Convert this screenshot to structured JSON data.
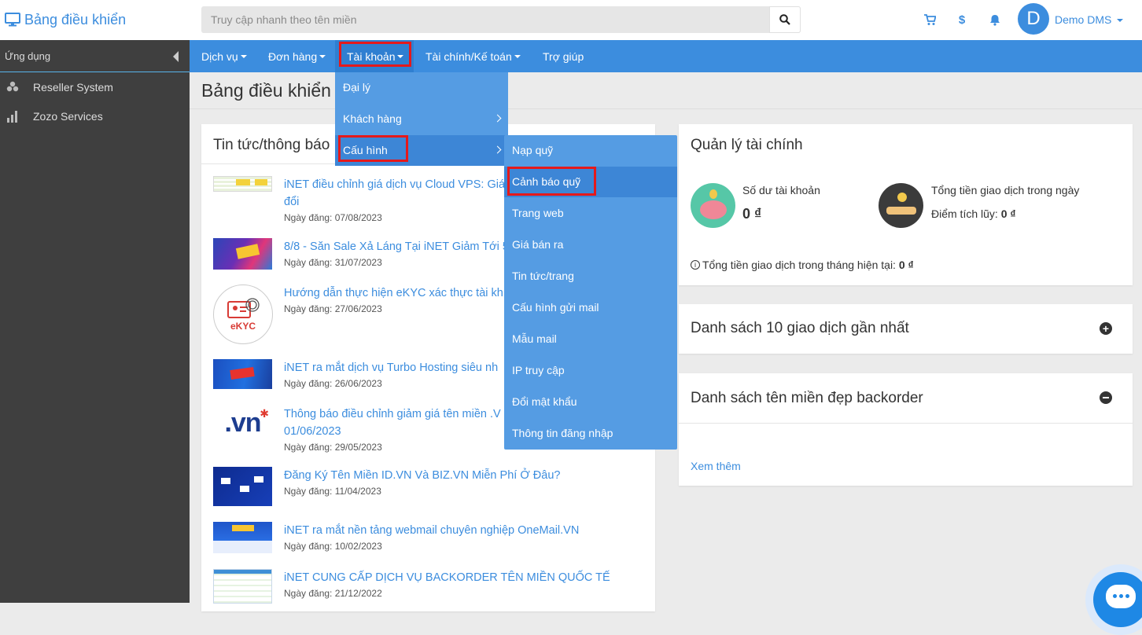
{
  "topbar": {
    "brand": "Bảng điều khiển",
    "search_placeholder": "Truy cập nhanh theo tên miền",
    "user_initial": "D",
    "user_name": "Demo DMS"
  },
  "sidebar": {
    "header": "Ứng dụng",
    "items": [
      {
        "label": "Reseller System",
        "icon": "network-icon"
      },
      {
        "label": "Zozo Services",
        "icon": "chart-icon"
      }
    ]
  },
  "nav": {
    "items": [
      {
        "label": "Dịch vụ"
      },
      {
        "label": "Đơn hàng"
      },
      {
        "label": "Tài khoản"
      },
      {
        "label": "Tài chính/Kế toán"
      },
      {
        "label": "Trợ giúp"
      }
    ]
  },
  "page": {
    "title": "Bảng điều khiển"
  },
  "news": {
    "title": "Tin tức/thông báo",
    "items": [
      {
        "title": "iNET điều chỉnh giá dịch vụ Cloud VPS: Giá mới áp dụng từ ngày ... không thay đổi",
        "title_line1": "iNET điều chỉnh giá dịch vụ Cloud VPS: Giá",
        "title_line2": "đổi",
        "date": "Ngày đăng: 07/08/2023"
      },
      {
        "title": "8/8 - Săn Sale Xả Láng Tại iNET Giảm Tới 5",
        "date": "Ngày đăng: 31/07/2023"
      },
      {
        "title": "Hướng dẫn thực hiện eKYC xác thực tài kh",
        "date": "Ngày đăng: 27/06/2023"
      },
      {
        "title": "iNET ra mắt dịch vụ Turbo Hosting siêu nh",
        "date": "Ngày đăng: 26/06/2023"
      },
      {
        "title_line1": "Thông báo điều chỉnh giảm giá tên miền .V",
        "title_line2": "01/06/2023",
        "date": "Ngày đăng: 29/05/2023"
      },
      {
        "title": "Đăng Ký Tên Miền ID.VN Và BIZ.VN Miễn Phí Ở Đâu?",
        "date": "Ngày đăng: 11/04/2023"
      },
      {
        "title": "iNET ra mắt nền tảng webmail chuyên nghiệp OneMail.VN",
        "date": "Ngày đăng: 10/02/2023"
      },
      {
        "title": "iNET CUNG CẤP DỊCH VỤ BACKORDER TÊN MIỀN QUỐC TẾ",
        "date": "Ngày đăng: 21/12/2022"
      }
    ],
    "thumb_labels": {
      "ekyc": "eKYC",
      "vn": ".vn"
    }
  },
  "finance": {
    "title": "Quản lý tài chính",
    "balance_label": "Số dư tài khoản",
    "balance_value": "0 ₫",
    "daily_label": "Tổng tiền giao dịch trong ngày",
    "points_label": "Điểm tích lũy:",
    "points_value": "0 ₫",
    "monthly_label": "Tổng tiền giao dịch trong tháng hiện tại:",
    "monthly_value": "0 ₫"
  },
  "recent": {
    "title": "Danh sách 10 giao dịch gần nhất"
  },
  "backorder": {
    "title": "Danh sách tên miền đẹp backorder",
    "more": "Xem thêm"
  },
  "dropdown_account": {
    "items": [
      {
        "label": "Đại lý"
      },
      {
        "label": "Khách hàng"
      },
      {
        "label": "Cấu hình"
      }
    ]
  },
  "dropdown_config": {
    "items": [
      {
        "label": "Nạp quỹ"
      },
      {
        "label": "Cảnh báo quỹ"
      },
      {
        "label": "Trang web"
      },
      {
        "label": "Giá bán ra"
      },
      {
        "label": "Tin tức/trang"
      },
      {
        "label": "Cấu hình gửi mail"
      },
      {
        "label": "Mẫu mail"
      },
      {
        "label": "IP truy cập"
      },
      {
        "label": "Đổi mật khẩu"
      },
      {
        "label": "Thông tin đăng nhập"
      }
    ]
  },
  "colors": {
    "primary": "#3c8dde",
    "sidebar": "#3f3f3f",
    "highlight": "#e5191b",
    "dropdown": "#559ce3"
  }
}
